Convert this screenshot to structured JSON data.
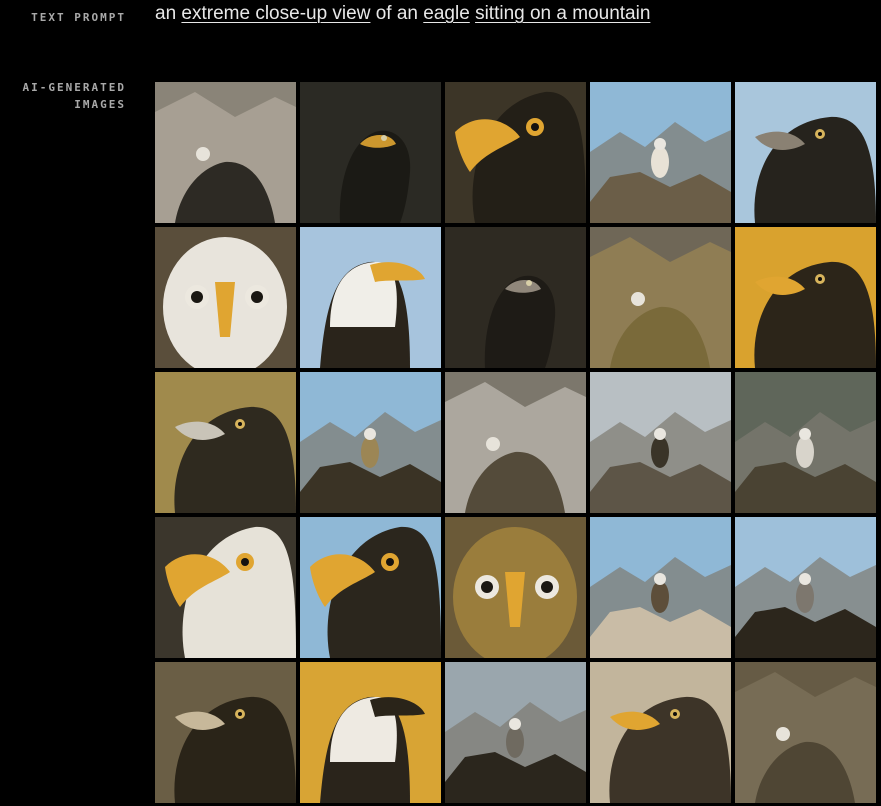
{
  "labels": {
    "text_prompt": "TEXT PROMPT",
    "ai_images_line1": "AI-GENERATED",
    "ai_images_line2": "IMAGES"
  },
  "prompt": {
    "t1": "an ",
    "w1": "extreme close-up view",
    "t2": " of an ",
    "w2": "eagle",
    "t3": " ",
    "w3": "sitting on a mountain"
  },
  "colors": {
    "background": "#000000",
    "beak_yellow": "#e0a531",
    "sky_blue": "#8fb8d6"
  },
  "images": [
    {
      "name": "eagle-image-1",
      "bg": "#8a8478",
      "fg": "#2d2a24",
      "accent": "#c9c2b4",
      "type": "rocky-closeup"
    },
    {
      "name": "eagle-image-2",
      "bg": "#2b2a24",
      "fg": "#1b1a15",
      "accent": "#e0a531",
      "type": "dark-head"
    },
    {
      "name": "eagle-image-3",
      "bg": "#3c3527",
      "fg": "#231f17",
      "accent": "#e0a531",
      "type": "yellow-beak"
    },
    {
      "name": "eagle-image-4",
      "bg": "#8fb8d6",
      "fg": "#6b5e48",
      "accent": "#e8e2d6",
      "type": "mountain-perch"
    },
    {
      "name": "eagle-image-5",
      "bg": "#a9c6dc",
      "fg": "#26231d",
      "accent": "#8a8173",
      "type": "head-profile"
    },
    {
      "name": "eagle-image-6",
      "bg": "#5a4e3b",
      "fg": "#e8e4dc",
      "accent": "#e0a531",
      "type": "front-face"
    },
    {
      "name": "eagle-image-7",
      "bg": "#a7c4dd",
      "fg": "#f0eee8",
      "accent": "#e0a531",
      "type": "bald-eagle"
    },
    {
      "name": "eagle-image-8",
      "bg": "#2e2a22",
      "fg": "#1e1b16",
      "accent": "#9c9486",
      "type": "dark-head"
    },
    {
      "name": "eagle-image-9",
      "bg": "#6f6757",
      "fg": "#7a6a3a",
      "accent": "#b59a52",
      "type": "rocky-closeup"
    },
    {
      "name": "eagle-image-10",
      "bg": "#d9a22e",
      "fg": "#2c2519",
      "accent": "#e0a531",
      "type": "head-profile"
    },
    {
      "name": "eagle-image-11",
      "bg": "#a08a4c",
      "fg": "#2f2a1f",
      "accent": "#c9c4b8",
      "type": "head-profile"
    },
    {
      "name": "eagle-image-12",
      "bg": "#8fb8d6",
      "fg": "#3a3325",
      "accent": "#9c8655",
      "type": "mountain-perch"
    },
    {
      "name": "eagle-image-13",
      "bg": "#7c776c",
      "fg": "#544b3a",
      "accent": "#e6e3dc",
      "type": "rocky-closeup"
    },
    {
      "name": "eagle-image-14",
      "bg": "#b8bfc3",
      "fg": "#5d5547",
      "accent": "#3a3428",
      "type": "mountain-perch"
    },
    {
      "name": "eagle-image-15",
      "bg": "#5f665a",
      "fg": "#4a4333",
      "accent": "#d8d4cb",
      "type": "mountain-perch"
    },
    {
      "name": "eagle-image-16",
      "bg": "#3b362c",
      "fg": "#e6e2d8",
      "accent": "#e0a531",
      "type": "yellow-beak"
    },
    {
      "name": "eagle-image-17",
      "bg": "#8fb8d6",
      "fg": "#2b261d",
      "accent": "#e0a531",
      "type": "yellow-beak"
    },
    {
      "name": "eagle-image-18",
      "bg": "#6b5a38",
      "fg": "#9a7d3c",
      "accent": "#e0a531",
      "type": "front-face"
    },
    {
      "name": "eagle-image-19",
      "bg": "#8fb8d6",
      "fg": "#c9bca6",
      "accent": "#5d4e3a",
      "type": "mountain-perch"
    },
    {
      "name": "eagle-image-20",
      "bg": "#9ec0da",
      "fg": "#2c261c",
      "accent": "#7d776e",
      "type": "mountain-perch"
    },
    {
      "name": "eagle-image-21",
      "bg": "#6a5e45",
      "fg": "#2a2418",
      "accent": "#c7b89a",
      "type": "head-profile"
    },
    {
      "name": "eagle-image-22",
      "bg": "#d8a434",
      "fg": "#eeeae2",
      "accent": "#2a2419",
      "type": "bald-eagle"
    },
    {
      "name": "eagle-image-23",
      "bg": "#9aa6ad",
      "fg": "#2b261d",
      "accent": "#6f6a60",
      "type": "mountain-perch"
    },
    {
      "name": "eagle-image-24",
      "bg": "#c2b59c",
      "fg": "#3d3428",
      "accent": "#e0a531",
      "type": "head-profile"
    },
    {
      "name": "eagle-image-25",
      "bg": "#665b45",
      "fg": "#4f4634",
      "accent": "#8b8068",
      "type": "rocky-closeup"
    }
  ]
}
